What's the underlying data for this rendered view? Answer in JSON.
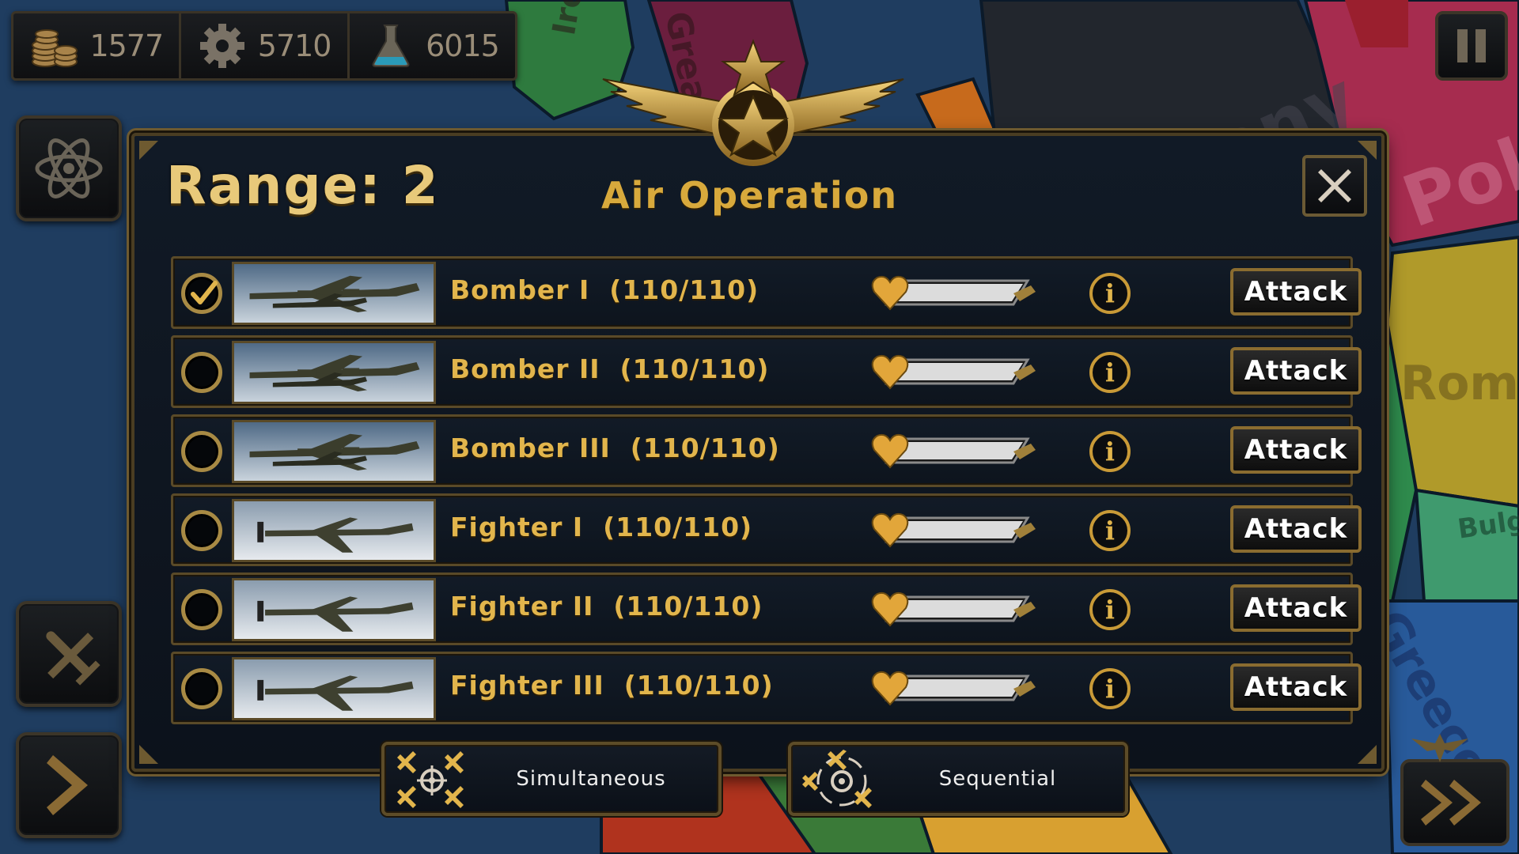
{
  "resources": {
    "gold": "1577",
    "industry": "5710",
    "science": "6015"
  },
  "map_labels": {
    "ireland": "Ireland",
    "great_britain": "Great B",
    "germany": "Germany",
    "poland": "Poland",
    "romania": "Rom",
    "bulgaria": "Bulg",
    "greece": "Greece"
  },
  "dialog": {
    "range_label": "Range: 2",
    "title": "Air Operation",
    "units": [
      {
        "name": "Bomber I  (110/110)",
        "selected": true,
        "type": "bomber",
        "health": 1.0,
        "info": "i",
        "action": "Attack"
      },
      {
        "name": "Bomber II  (110/110)",
        "selected": false,
        "type": "bomber",
        "health": 1.0,
        "info": "i",
        "action": "Attack"
      },
      {
        "name": "Bomber III  (110/110)",
        "selected": false,
        "type": "bomber",
        "health": 1.0,
        "info": "i",
        "action": "Attack"
      },
      {
        "name": "Fighter I  (110/110)",
        "selected": false,
        "type": "fighter",
        "health": 1.0,
        "info": "i",
        "action": "Attack"
      },
      {
        "name": "Fighter II  (110/110)",
        "selected": false,
        "type": "fighter",
        "health": 1.0,
        "info": "i",
        "action": "Attack"
      },
      {
        "name": "Fighter III  (110/110)",
        "selected": false,
        "type": "fighter",
        "health": 1.0,
        "info": "i",
        "action": "Attack"
      }
    ],
    "modes": {
      "simultaneous": "Simultaneous",
      "sequential": "Sequential"
    }
  },
  "colors": {
    "gold": "#e2b54c",
    "frame": "#5a4a28",
    "panel": "#0d141d"
  },
  "icons": {
    "gold": "coins-icon",
    "industry": "gear-icon",
    "science": "flask-icon",
    "research": "atom-icon",
    "air": "airplane-icon",
    "next": "chevron-right-icon",
    "end_turn": "double-chevron-icon",
    "pause": "pause-icon",
    "close": "close-icon"
  }
}
